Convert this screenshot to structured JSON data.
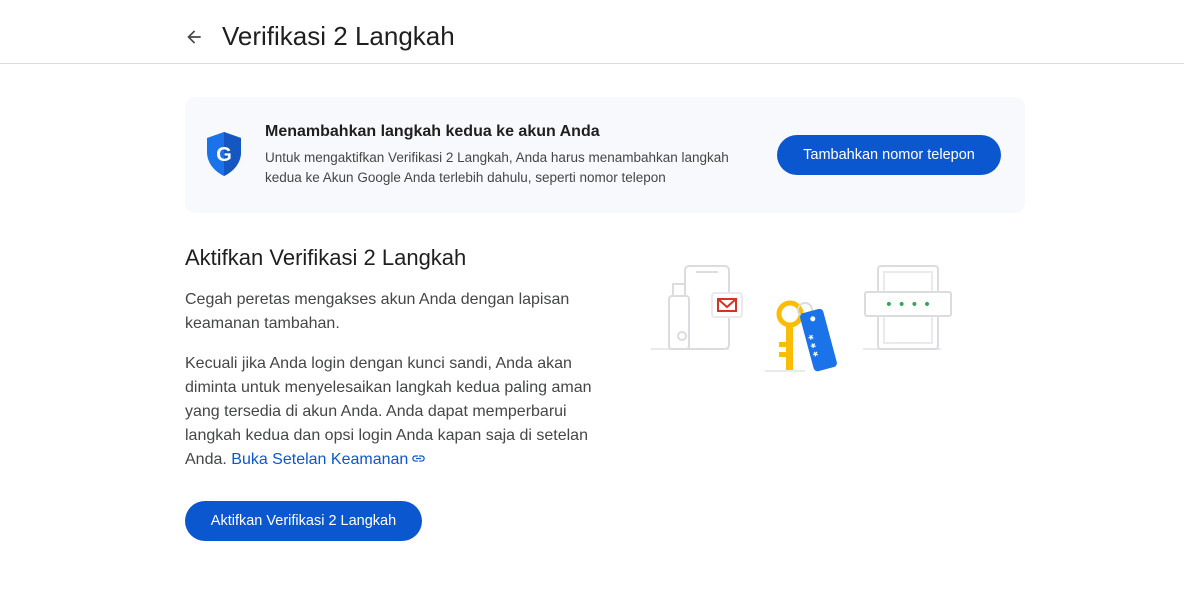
{
  "header": {
    "back_icon": "arrow-back-icon",
    "title": "Verifikasi 2 Langkah"
  },
  "banner": {
    "icon": "google-shield-icon",
    "shield_letter": "G",
    "title": "Menambahkan langkah kedua ke akun Anda",
    "description": "Untuk mengaktifkan Verifikasi 2 Langkah, Anda harus menambahkan langkah kedua ke Akun Google Anda terlebih dahulu, seperti nomor telepon",
    "button_label": "Tambahkan nomor telepon"
  },
  "section": {
    "title": "Aktifkan Verifikasi 2 Langkah",
    "paragraph1": "Cegah peretas mengakses akun Anda dengan lapisan keamanan tambahan.",
    "paragraph2": "Kecuali jika Anda login dengan kunci sandi, Anda akan diminta untuk menyelesaikan langkah kedua paling aman yang tersedia di akun Anda. Anda dapat memperbarui langkah kedua dan opsi login Anda kapan saja di setelan Anda.",
    "link_label": "Buka Setelan Keamanan",
    "link_icon": "link-icon",
    "button_label": "Aktifkan Verifikasi 2 Langkah"
  },
  "illustration": {
    "icons": [
      "phone-icon",
      "mail-icon",
      "key-icon",
      "password-tag-icon",
      "password-screen-icon"
    ],
    "tag_text": "* * *",
    "password_dots": "• • • •"
  },
  "colors": {
    "primary": "#0b57d0",
    "banner_bg": "#f8f9fc",
    "shield": "#1a73e8",
    "key": "#fbbc04",
    "mail": "#d93025",
    "dots": "#34a853"
  }
}
